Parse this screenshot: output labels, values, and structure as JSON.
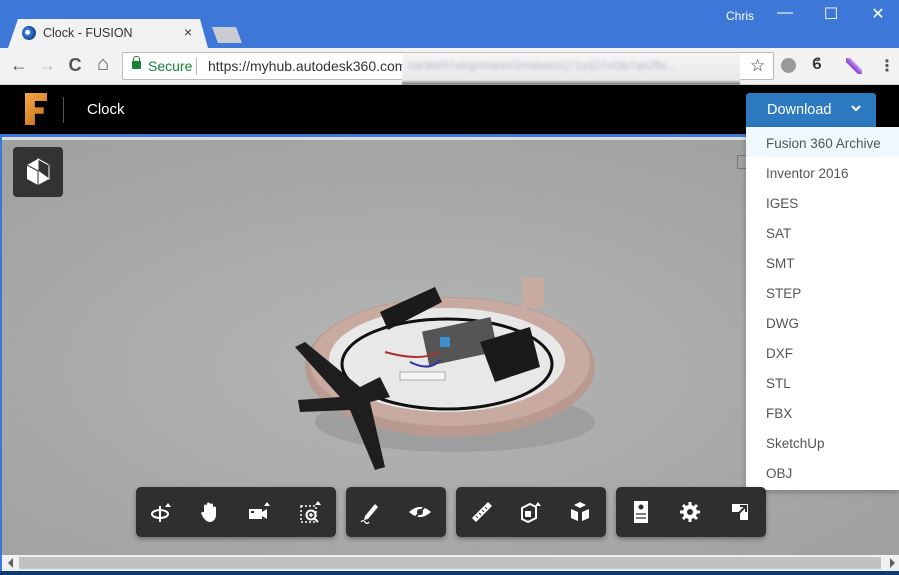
{
  "browser": {
    "tab_title": "Clock - FUSION",
    "tab_close": "×",
    "user_name": "Chris",
    "window_controls": {
      "minimize": "—",
      "maximize": "☐",
      "close": "✕"
    },
    "nav": {
      "back": "←",
      "forward": "→",
      "reload": "C",
      "home": "⌂"
    },
    "secure_label": "Secure",
    "url": "https://myhub.autodesk360.com",
    "url_blurred": "/ue3b957a6/g/shares/SHabee1Q71a327c63b7ab2ffa…",
    "bookmark_icon": "☆",
    "extensions": [
      "speech-bubble-icon",
      "flame-icon",
      "feather-icon"
    ],
    "menu_icon": "⋮"
  },
  "app": {
    "title": "Clock",
    "download": {
      "label": "Download",
      "options": [
        "Fusion 360 Archive",
        "Inventor 2016",
        "IGES",
        "SAT",
        "SMT",
        "STEP",
        "DWG",
        "DXF",
        "STL",
        "FBX",
        "SketchUp",
        "OBJ"
      ],
      "highlighted_index": 0
    },
    "toolbar_groups": [
      [
        "orbit-icon",
        "pan-icon",
        "camera-icon",
        "zoom-window-icon"
      ],
      [
        "markup-icon",
        "hide-icon"
      ],
      [
        "measure-icon",
        "section-icon",
        "explode-icon"
      ],
      [
        "model-browser-icon",
        "settings-icon",
        "fullscreen-icon"
      ]
    ]
  }
}
